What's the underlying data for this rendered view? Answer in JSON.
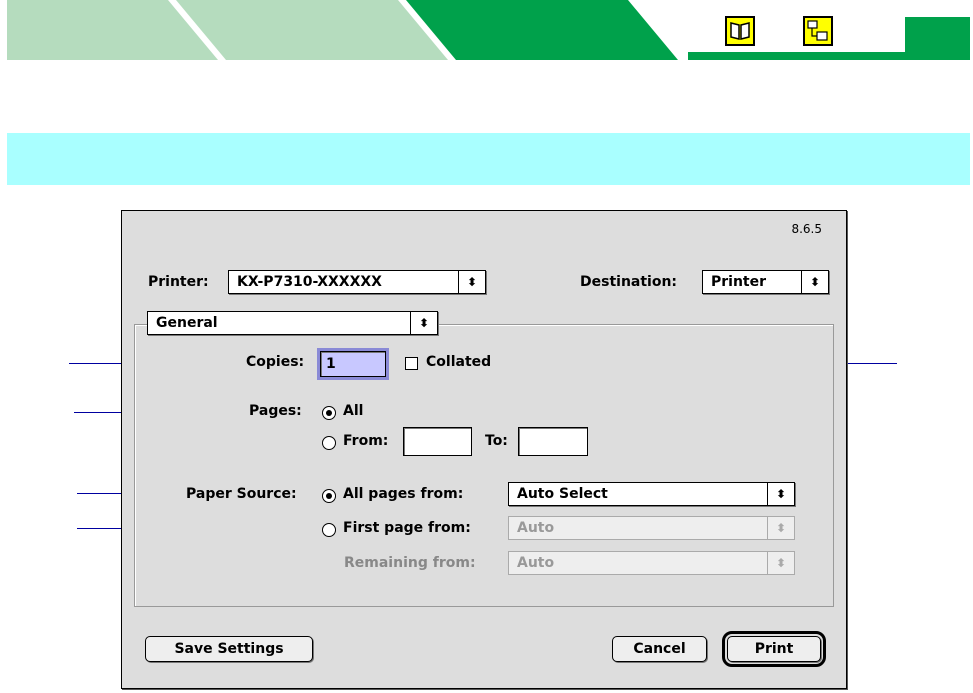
{
  "dialog": {
    "version": "8.6.5",
    "printer_label": "Printer:",
    "printer_value": "KX-P7310-XXXXXX",
    "destination_label": "Destination:",
    "destination_value": "Printer",
    "panel_value": "General",
    "copies_label": "Copies:",
    "copies_value": "1",
    "collated_label": "Collated",
    "collated_checked": false,
    "pages_label": "Pages:",
    "pages_all_label": "All",
    "pages_from_label": "From:",
    "pages_to_label": "To:",
    "pages_from_value": "",
    "pages_to_value": "",
    "pages_selected": "All",
    "paper_source_label": "Paper Source:",
    "all_pages_from_label": "All pages from:",
    "all_pages_from_value": "Auto Select",
    "first_page_from_label": "First page from:",
    "first_page_from_value": "Auto",
    "remaining_from_label": "Remaining from:",
    "remaining_from_value": "Auto",
    "paper_source_selected": "All pages from",
    "save_settings_label": "Save Settings",
    "cancel_label": "Cancel",
    "print_label": "Print"
  },
  "colors": {
    "banner_dark_green": "#00a14b",
    "banner_light_green": "#b5dcbe",
    "highlight_cyan": "#a9ffff",
    "callout_blue": "#0000a0",
    "icon_yellow": "#ffff00"
  },
  "icons": [
    "book-icon",
    "network-icon",
    "up-down-arrows-icon"
  ]
}
